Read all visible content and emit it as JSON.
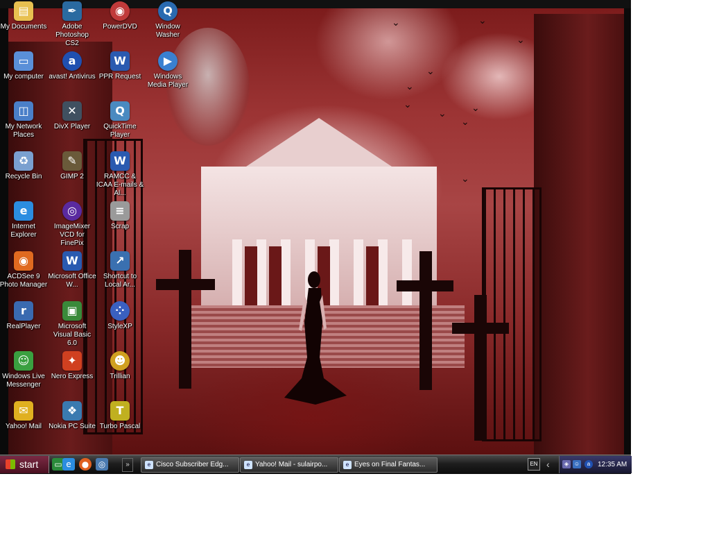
{
  "desktop_icons": [
    {
      "label": "My Documents",
      "icon": "folder-documents-icon",
      "color": "#e8c050"
    },
    {
      "label": "My computer",
      "icon": "computer-icon",
      "color": "#5a8fd8"
    },
    {
      "label": "My Network Places",
      "icon": "network-places-icon",
      "color": "#4a7fc8"
    },
    {
      "label": "Recycle Bin",
      "icon": "recycle-bin-icon",
      "color": "#7aa0d0"
    },
    {
      "label": "Internet Explorer",
      "icon": "internet-explorer-icon",
      "color": "#2b8de0"
    },
    {
      "label": "ACDSee 9 Photo Manager",
      "icon": "acdsee-icon",
      "color": "#e06a20"
    },
    {
      "label": "RealPlayer",
      "icon": "realplayer-icon",
      "color": "#3a6ab0"
    },
    {
      "label": "Windows Live Messenger",
      "icon": "messenger-icon",
      "color": "#3aa040"
    },
    {
      "label": "Yahoo! Mail",
      "icon": "yahoo-mail-icon",
      "color": "#e0b020"
    },
    {
      "label": "Adobe Photoshop CS2",
      "icon": "photoshop-icon",
      "color": "#2a6aa0"
    },
    {
      "label": "avast! Antivirus",
      "icon": "avast-icon",
      "color": "#2050b0"
    },
    {
      "label": "DivX Player",
      "icon": "divx-player-icon",
      "color": "#405060"
    },
    {
      "label": "GIMP 2",
      "icon": "gimp-icon",
      "color": "#6a5a3a"
    },
    {
      "label": "ImageMixer VCD for FinePix",
      "icon": "imagemixer-icon",
      "color": "#5a2aa0"
    },
    {
      "label": "Microsoft Office W...",
      "icon": "word-document-icon",
      "color": "#2a5ab0"
    },
    {
      "label": "Microsoft Visual Basic 6.0",
      "icon": "visual-basic-icon",
      "color": "#3a8a3a"
    },
    {
      "label": "Nero Express",
      "icon": "nero-express-icon",
      "color": "#d04020"
    },
    {
      "label": "Nokia PC Suite",
      "icon": "nokia-pc-suite-icon",
      "color": "#3a7ab0"
    },
    {
      "label": "PowerDVD",
      "icon": "powerdvd-icon",
      "color": "#c03a3a"
    },
    {
      "label": "PPR Request",
      "icon": "word-document-icon",
      "color": "#2a5ab0"
    },
    {
      "label": "QuickTime Player",
      "icon": "quicktime-icon",
      "color": "#4a8ac0"
    },
    {
      "label": "RAMCC & ICAA E-mails & Al...",
      "icon": "word-document-icon",
      "color": "#2a5ab0"
    },
    {
      "label": "Scrap",
      "icon": "text-file-icon",
      "color": "#9a9a9a"
    },
    {
      "label": "Shortcut to Local Ar...",
      "icon": "shortcut-icon",
      "color": "#3a70b0"
    },
    {
      "label": "StyleXP",
      "icon": "stylexp-icon",
      "color": "#3a60c0"
    },
    {
      "label": "Trillian",
      "icon": "trillian-icon",
      "color": "#d0a020"
    },
    {
      "label": "Turbo Pascal",
      "icon": "turbo-pascal-icon",
      "color": "#c0b020"
    },
    {
      "label": "Window Washer",
      "icon": "window-washer-icon",
      "color": "#2a6ab0"
    },
    {
      "label": "Windows Media Player",
      "icon": "media-player-icon",
      "color": "#3a80d0"
    }
  ],
  "taskbar": {
    "start_label": "start",
    "quick_launch": [
      {
        "name": "show-desktop-icon",
        "glyph": "▭",
        "color": "#2a8a3a"
      },
      {
        "name": "internet-explorer-icon",
        "glyph": "e",
        "color": "#2b8de0"
      },
      {
        "name": "firefox-icon",
        "glyph": "●",
        "color": "#e06020"
      },
      {
        "name": "search-icon",
        "glyph": "◎",
        "color": "#4a7ab0"
      }
    ],
    "quick_launch_more": "»",
    "tasks": [
      {
        "label": "Cisco Subscriber Edg...",
        "icon": "ie"
      },
      {
        "label": "Yahoo! Mail - sulairpo...",
        "icon": "ie"
      },
      {
        "label": "Eyes on Final Fantas...",
        "icon": "ie"
      }
    ],
    "language": "EN",
    "tray_arrow": "‹",
    "clock": "12:35 AM"
  }
}
